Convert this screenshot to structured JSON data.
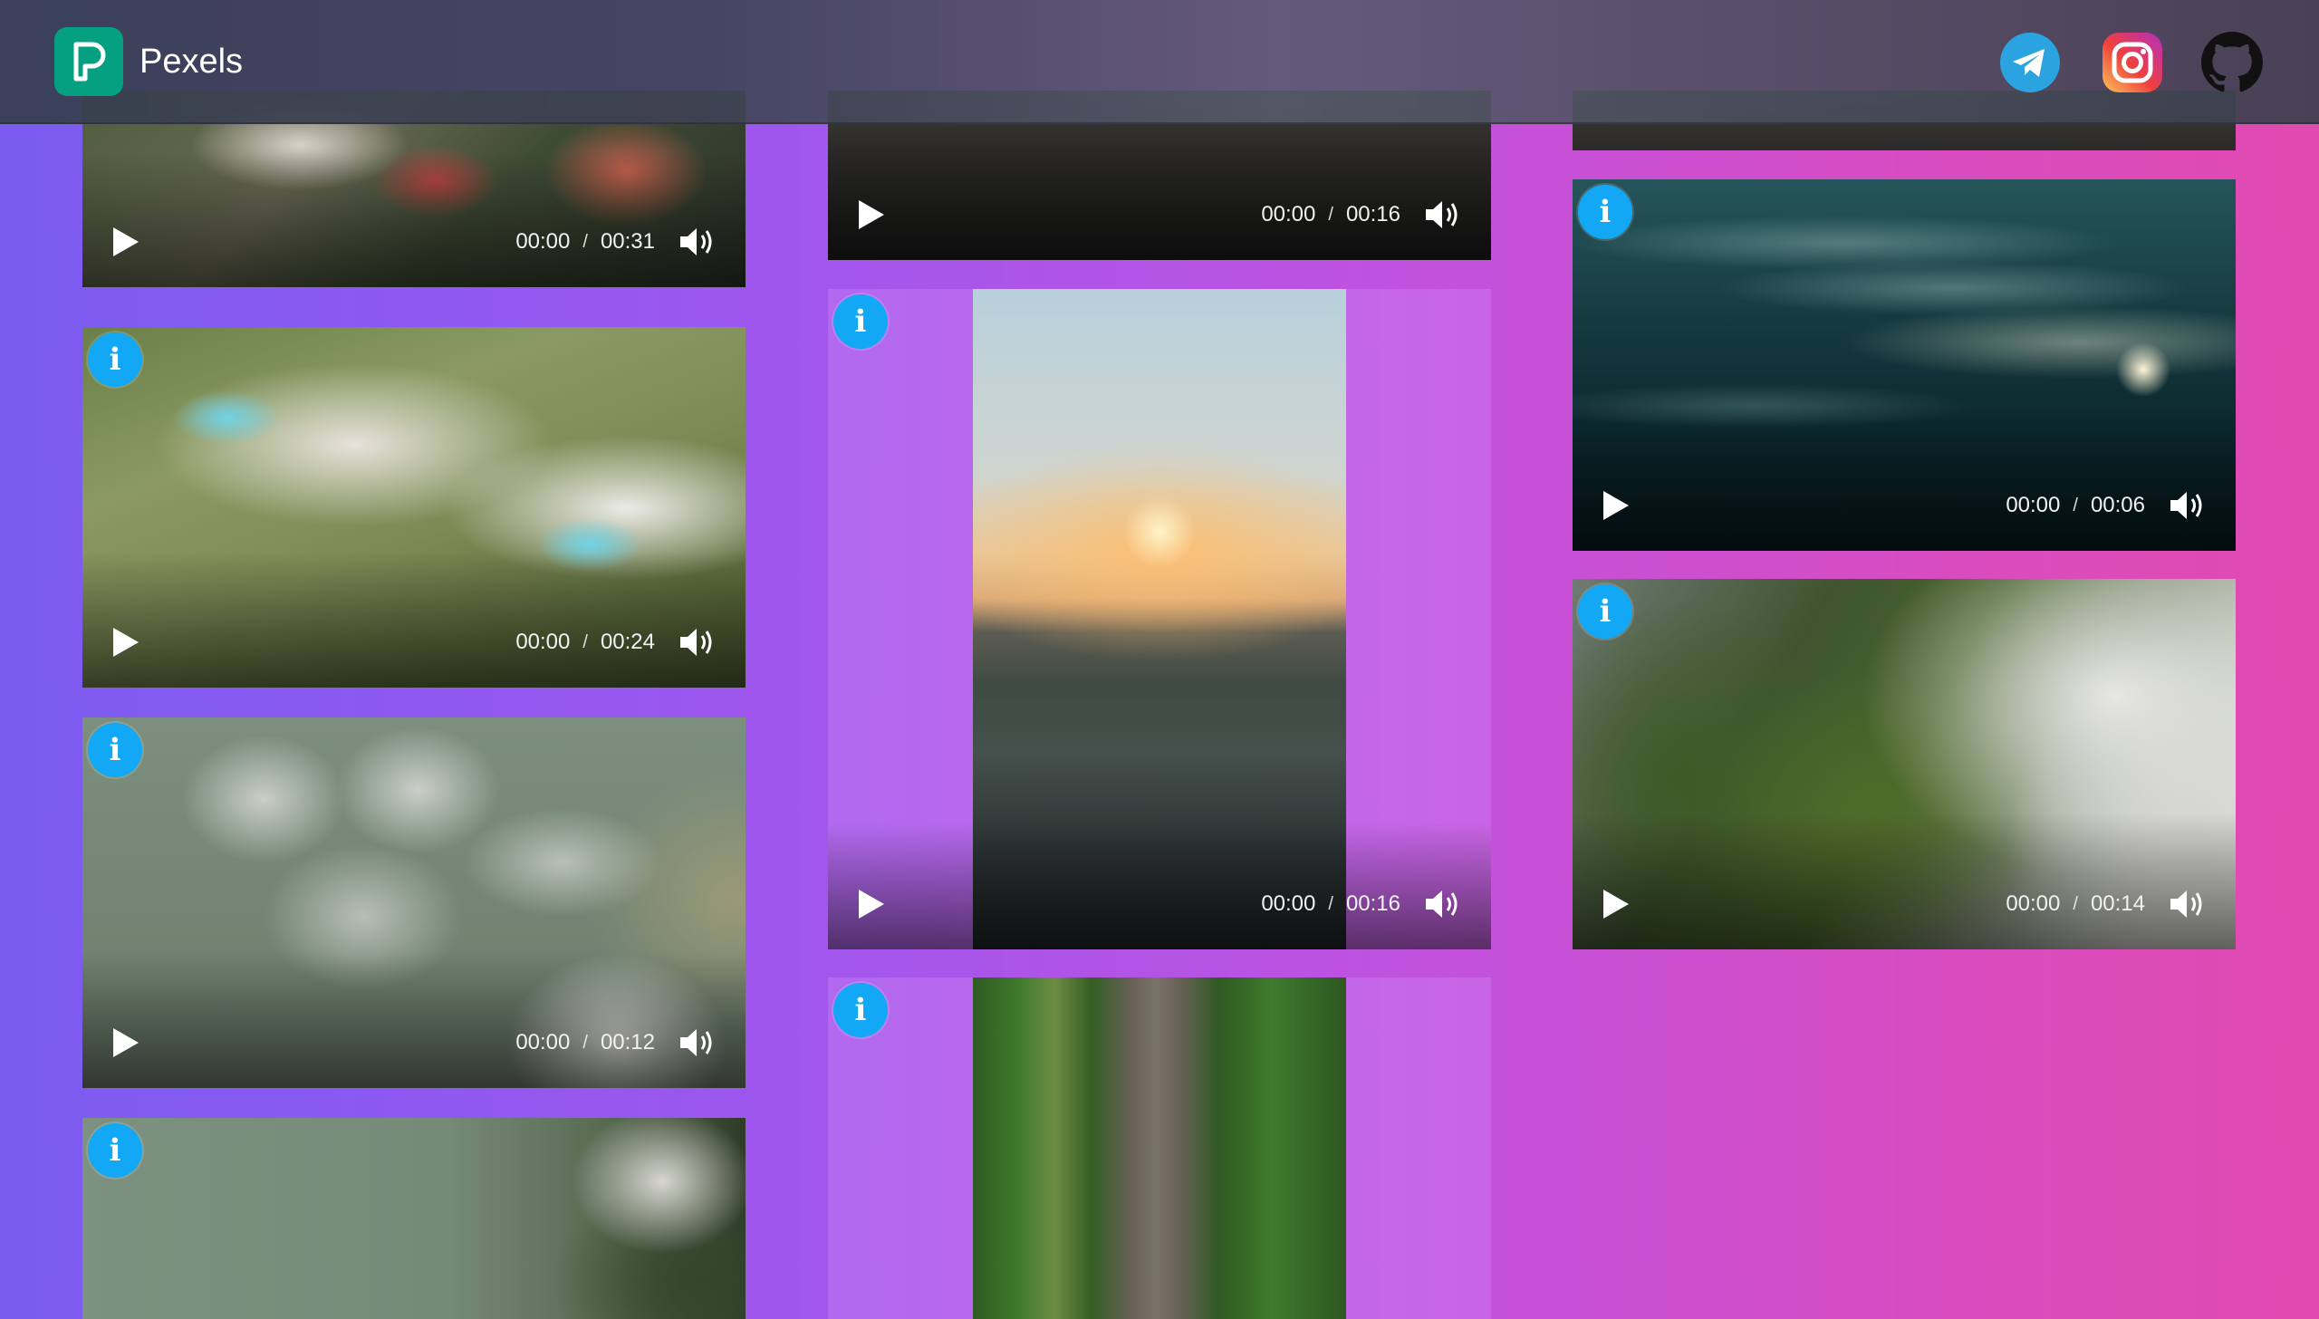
{
  "app": {
    "brand_name": "Pexels",
    "social": [
      {
        "name": "telegram",
        "color": "#2aa3e0"
      },
      {
        "name": "instagram",
        "color": "#e1306c"
      },
      {
        "name": "github",
        "color": "#111111"
      }
    ]
  },
  "colors": {
    "accent_info": "#12a8f5",
    "brand_logo": "#05a081"
  },
  "videos": [
    {
      "id": "c1-v1",
      "current": "00:00",
      "sep": "/",
      "duration": "00:31"
    },
    {
      "id": "c1-v2",
      "current": "00:00",
      "sep": "/",
      "duration": "00:24"
    },
    {
      "id": "c1-v3",
      "current": "00:00",
      "sep": "/",
      "duration": "00:12"
    },
    {
      "id": "c1-v4"
    },
    {
      "id": "c2-v1",
      "current": "00:00",
      "sep": "/",
      "duration": "00:16"
    },
    {
      "id": "c2-v2",
      "current": "00:00",
      "sep": "/",
      "duration": "00:16"
    },
    {
      "id": "c2-v3"
    },
    {
      "id": "c3-v1"
    },
    {
      "id": "c3-v2",
      "current": "00:00",
      "sep": "/",
      "duration": "00:06"
    },
    {
      "id": "c3-v3",
      "current": "00:00",
      "sep": "/",
      "duration": "00:14"
    }
  ],
  "icons": {
    "info": "i"
  }
}
